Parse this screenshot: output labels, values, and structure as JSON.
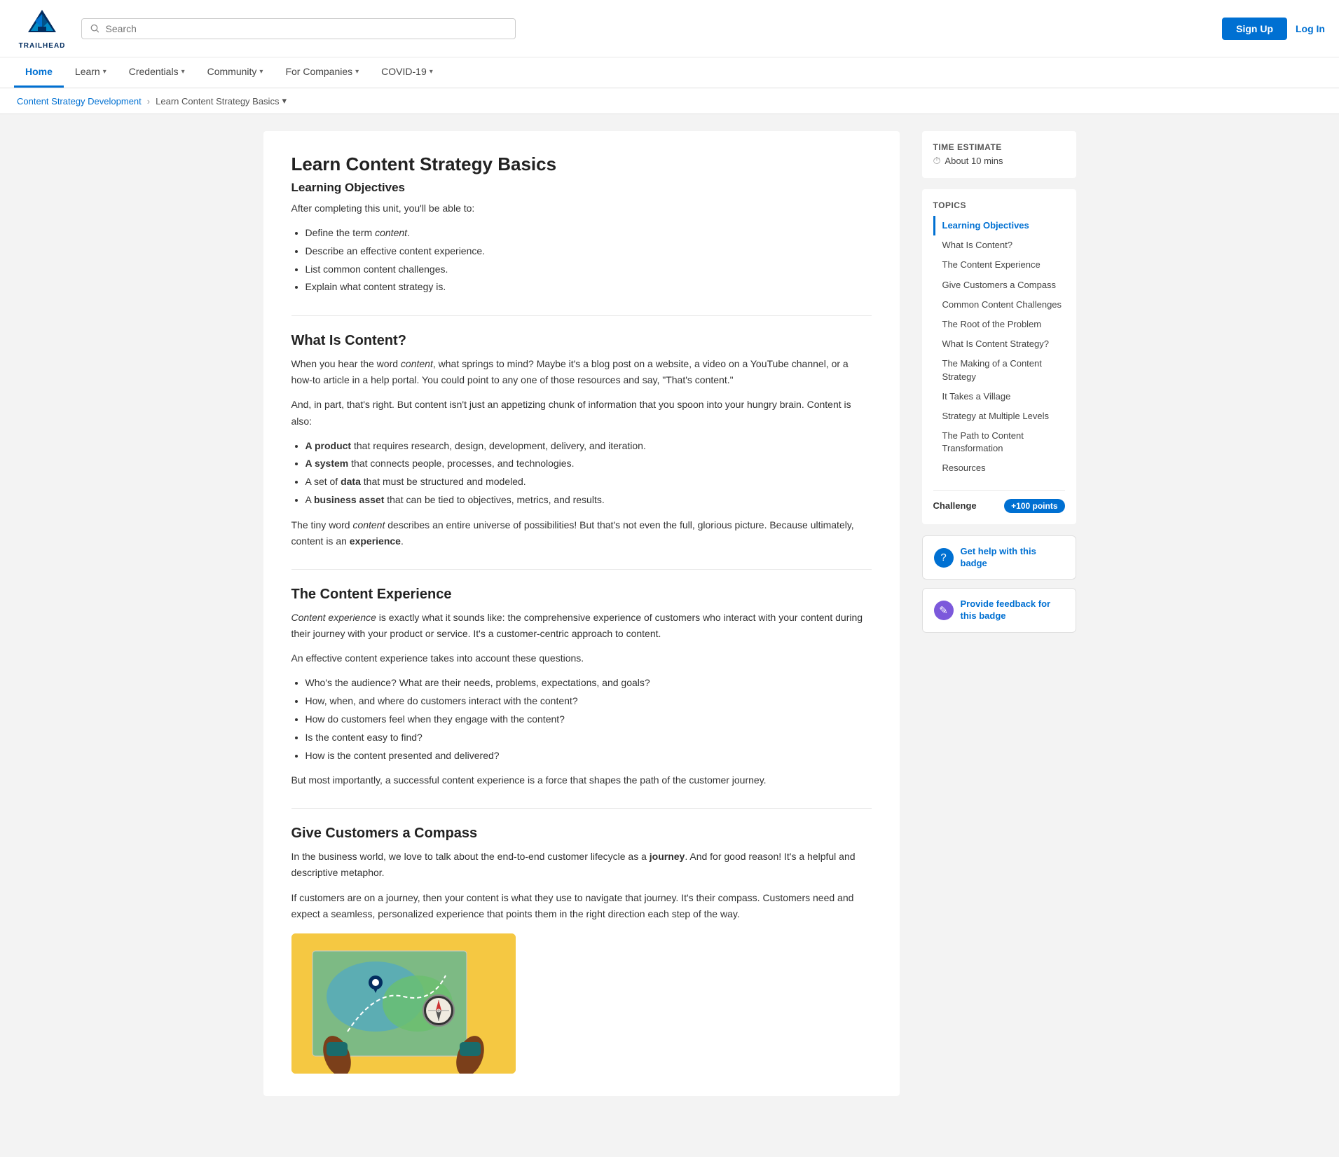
{
  "header": {
    "logo_text": "TRAILHEAD",
    "search_placeholder": "Search",
    "signup_label": "Sign Up",
    "login_label": "Log In"
  },
  "nav": {
    "items": [
      {
        "label": "Home",
        "active": true,
        "has_dropdown": false
      },
      {
        "label": "Learn",
        "active": false,
        "has_dropdown": true
      },
      {
        "label": "Credentials",
        "active": false,
        "has_dropdown": true
      },
      {
        "label": "Community",
        "active": false,
        "has_dropdown": true
      },
      {
        "label": "For Companies",
        "active": false,
        "has_dropdown": true
      },
      {
        "label": "COVID-19",
        "active": false,
        "has_dropdown": true
      }
    ]
  },
  "breadcrumb": {
    "parent": "Content Strategy Development",
    "current": "Learn Content Strategy Basics"
  },
  "content": {
    "page_title": "Learn Content Strategy Basics",
    "sections": [
      {
        "id": "learning-objectives",
        "title": "Learning Objectives",
        "intro": "After completing this unit, you'll be able to:",
        "bullets": [
          "Define the term content.",
          "Describe an effective content experience.",
          "List common content challenges.",
          "Explain what content strategy is."
        ]
      },
      {
        "id": "what-is-content",
        "title": "What Is Content?",
        "paragraphs": [
          "When you hear the word content, what springs to mind? Maybe it's a blog post on a website, a video on a YouTube channel, or a how-to article in a help portal. You could point to any one of those resources and say, \"That's content.\"",
          "And, in part, that's right. But content isn't just an appetizing chunk of information that you spoon into your hungry brain. Content is also:"
        ],
        "bullets": [
          {
            "bold": "A product",
            "rest": " that requires research, design, development, delivery, and iteration."
          },
          {
            "bold": "A system",
            "rest": " that connects people, processes, and technologies."
          },
          {
            "bold": "A set of data",
            "rest": " that must be structured and modeled."
          },
          {
            "bold": "A business asset",
            "rest": " that can be tied to objectives, metrics, and results."
          }
        ],
        "closing": "The tiny word content describes an entire universe of possibilities! But that's not even the full, glorious picture. Because ultimately, content is an experience."
      },
      {
        "id": "content-experience",
        "title": "The Content Experience",
        "paragraphs": [
          "Content experience is exactly what it sounds like: the comprehensive experience of customers who interact with your content during their journey with your product or service. It's a customer-centric approach to content.",
          "An effective content experience takes into account these questions."
        ],
        "bullets": [
          "Who's the audience? What are their needs, problems, expectations, and goals?",
          "How, when, and where do customers interact with the content?",
          "How do customers feel when they engage with the content?",
          "Is the content easy to find?",
          "How is the content presented and delivered?"
        ],
        "closing": "But most importantly, a successful content experience is a force that shapes the path of the customer journey."
      },
      {
        "id": "give-customers-compass",
        "title": "Give Customers a Compass",
        "paragraphs": [
          "In the business world, we love to talk about the end-to-end customer lifecycle as a journey. And for good reason! It's a helpful and descriptive metaphor.",
          "If customers are on a journey, then your content is what they use to navigate that journey. It's their compass. Customers need and expect a seamless, personalized experience that points them in the right direction each step of the way."
        ]
      }
    ]
  },
  "sidebar": {
    "time_estimate_label": "Time Estimate",
    "time_estimate_value": "About 10 mins",
    "topics_label": "Topics",
    "topics": [
      {
        "label": "Learning Objectives",
        "active": true
      },
      {
        "label": "What Is Content?",
        "active": false
      },
      {
        "label": "The Content Experience",
        "active": false
      },
      {
        "label": "Give Customers a Compass",
        "active": false
      },
      {
        "label": "Common Content Challenges",
        "active": false
      },
      {
        "label": "The Root of the Problem",
        "active": false
      },
      {
        "label": "What Is Content Strategy?",
        "active": false
      },
      {
        "label": "The Making of a Content Strategy",
        "active": false
      },
      {
        "label": "It Takes a Village",
        "active": false
      },
      {
        "label": "Strategy at Multiple Levels",
        "active": false
      },
      {
        "label": "The Path to Content Transformation",
        "active": false
      },
      {
        "label": "Resources",
        "active": false
      }
    ],
    "challenge_label": "Challenge",
    "points_label": "+100 points",
    "help_btn_label": "Get help with this badge",
    "feedback_btn_label": "Provide feedback for this badge"
  }
}
